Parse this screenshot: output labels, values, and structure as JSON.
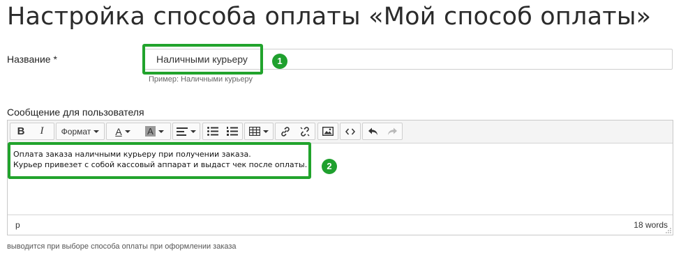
{
  "page": {
    "title": "Настройка способа оплаты «Мой способ оплаты»"
  },
  "name_field": {
    "label": "Название *",
    "value": "Наличными курьеру",
    "hint": "Пример: Наличными курьеру",
    "badge": "1"
  },
  "message_field": {
    "label": "Сообщение для пользователя",
    "lines": [
      "Оплата заказа наличными курьеру при получении заказа.",
      "Курьер привезет с собой кассовый аппарат и выдаст чек после оплаты."
    ],
    "badge": "2",
    "status_path": "p",
    "word_count": "18 words",
    "hint": "выводится при выборе способа оплаты при оформлении заказа"
  },
  "toolbar": {
    "bold": "B",
    "italic": "I",
    "format_label": "Формат",
    "text_color_letter": "A",
    "bg_color_letter": "A"
  },
  "colors": {
    "highlight": "#21a32c",
    "badge": "#1fa02e"
  }
}
